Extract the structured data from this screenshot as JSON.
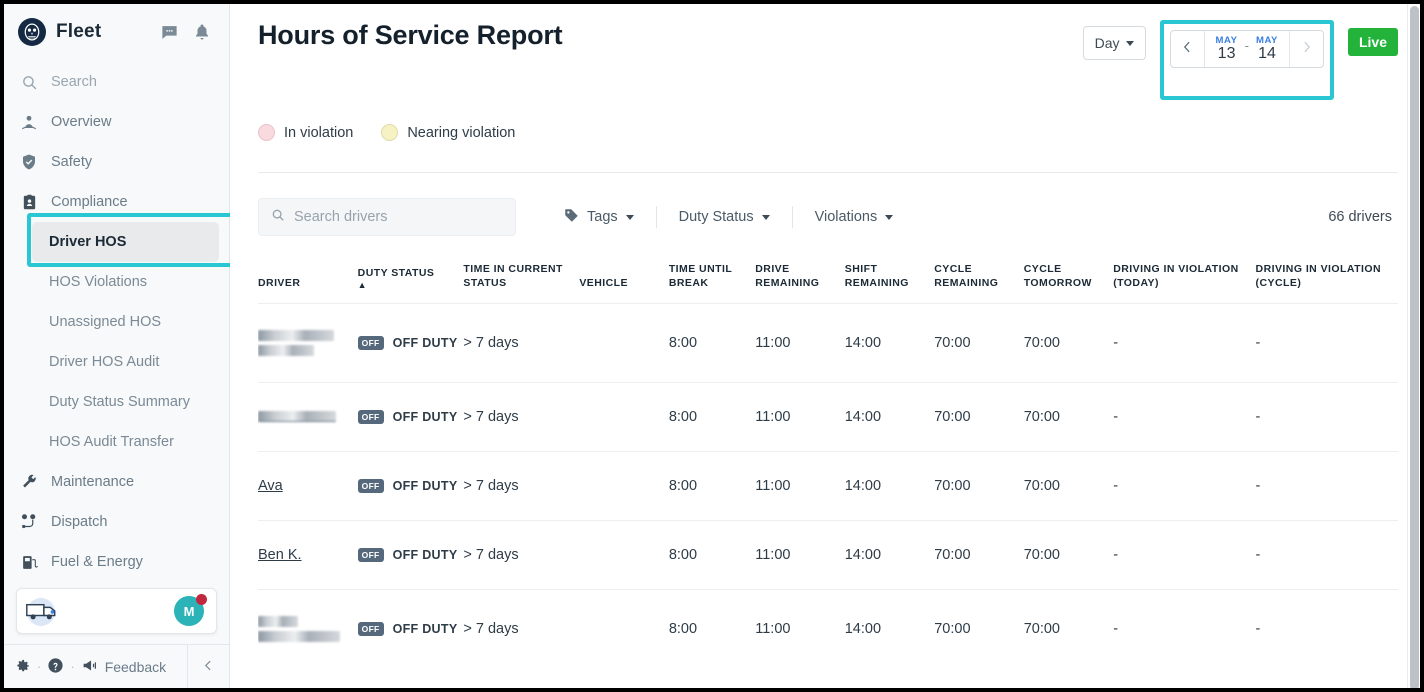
{
  "sidebar": {
    "brand": "Fleet",
    "logo_icon": "owl-logo-icon",
    "header_icons": [
      {
        "name": "chat-icon",
        "label": "Messages"
      },
      {
        "name": "bell-icon",
        "label": "Notifications"
      }
    ],
    "items": [
      {
        "label": "Search",
        "icon": "search-icon",
        "type": "nav",
        "muted": true
      },
      {
        "label": "Overview",
        "icon": "map-pin-icon",
        "type": "nav"
      },
      {
        "label": "Safety",
        "icon": "shield-check-icon",
        "type": "nav"
      },
      {
        "label": "Compliance",
        "icon": "clipboard-id-icon",
        "type": "nav"
      },
      {
        "label": "Driver HOS",
        "type": "sub",
        "active": true
      },
      {
        "label": "HOS Violations",
        "type": "sub"
      },
      {
        "label": "Unassigned HOS",
        "type": "sub"
      },
      {
        "label": "Driver HOS Audit",
        "type": "sub"
      },
      {
        "label": "Duty Status Summary",
        "type": "sub"
      },
      {
        "label": "HOS Audit Transfer",
        "type": "sub"
      },
      {
        "label": "Maintenance",
        "icon": "wrench-icon",
        "type": "nav"
      },
      {
        "label": "Dispatch",
        "icon": "route-icon",
        "type": "nav"
      },
      {
        "label": "Fuel & Energy",
        "icon": "fuel-pump-icon",
        "type": "nav"
      }
    ],
    "vehicle_card": {
      "truck_icon": "truck-icon",
      "avatar_initial": "M",
      "avatar_color": "#2bb3b8",
      "badge_color": "#c0283d"
    },
    "footer": {
      "gear_icon": "gear-icon",
      "help_icon": "help-circle-icon",
      "megaphone_icon": "megaphone-icon",
      "feedback_label": "Feedback",
      "collapse_icon": "chevron-left-icon",
      "separator": "·"
    },
    "highlight_color": "#29c7d4"
  },
  "header": {
    "title": "Hours of Service Report",
    "day_selector": {
      "label": "Day",
      "caret_icon": "caret-down-icon"
    },
    "date_range": {
      "prev_icon": "chevron-left-icon",
      "next_icon": "chevron-right-icon",
      "start_month": "MAY",
      "start_day": "13",
      "separator": "-",
      "end_month": "MAY",
      "end_day": "14",
      "month_color": "#3a7fe0"
    },
    "live_button": {
      "label": "Live",
      "color": "#23b33a"
    }
  },
  "legend": [
    {
      "label": "In violation",
      "color": "#f9dadf"
    },
    {
      "label": "Nearing violation",
      "color": "#f6f2c4"
    }
  ],
  "filters": {
    "search": {
      "placeholder": "Search drivers",
      "icon": "search-icon",
      "value": ""
    },
    "buttons": [
      {
        "label": "Tags",
        "icon": "tag-icon",
        "caret_icon": "caret-down-icon"
      },
      {
        "label": "Duty Status",
        "caret_icon": "caret-down-icon"
      },
      {
        "label": "Violations",
        "caret_icon": "caret-down-icon"
      }
    ],
    "drivers_count": "66 drivers"
  },
  "table": {
    "columns": [
      {
        "label": "DRIVER",
        "sorted": false
      },
      {
        "label": "DUTY STATUS",
        "sorted": true,
        "sort_icon": "sort-asc-icon"
      },
      {
        "label": "TIME IN CURRENT STATUS",
        "sorted": false
      },
      {
        "label": "VEHICLE",
        "sorted": false
      },
      {
        "label": "TIME UNTIL BREAK",
        "sorted": false
      },
      {
        "label": "DRIVE REMAINING",
        "sorted": false
      },
      {
        "label": "SHIFT REMAINING",
        "sorted": false
      },
      {
        "label": "CYCLE REMAINING",
        "sorted": false
      },
      {
        "label": "CYCLE TOMORROW",
        "sorted": false
      },
      {
        "label": "DRIVING IN VIOLATION (TODAY)",
        "sorted": false
      },
      {
        "label": "DRIVING IN VIOLATION (CYCLE)",
        "sorted": false
      }
    ],
    "rows": [
      {
        "driver": "",
        "driver_redacted": true,
        "redact_lines": 2,
        "duty_badge": "OFF",
        "duty_status": "OFF DUTY",
        "time_in_status": "> 7 days",
        "vehicle": "",
        "time_until_break": "8:00",
        "drive_remaining": "11:00",
        "shift_remaining": "14:00",
        "cycle_remaining": "70:00",
        "cycle_tomorrow": "70:00",
        "violation_today": "-",
        "violation_cycle": "-"
      },
      {
        "driver": "",
        "driver_redacted": true,
        "redact_lines": 1,
        "duty_badge": "OFF",
        "duty_status": "OFF DUTY",
        "time_in_status": "> 7 days",
        "vehicle": "",
        "time_until_break": "8:00",
        "drive_remaining": "11:00",
        "shift_remaining": "14:00",
        "cycle_remaining": "70:00",
        "cycle_tomorrow": "70:00",
        "violation_today": "-",
        "violation_cycle": "-"
      },
      {
        "driver": "Ava",
        "driver_redacted": false,
        "duty_badge": "OFF",
        "duty_status": "OFF DUTY",
        "time_in_status": "> 7 days",
        "vehicle": "",
        "time_until_break": "8:00",
        "drive_remaining": "11:00",
        "shift_remaining": "14:00",
        "cycle_remaining": "70:00",
        "cycle_tomorrow": "70:00",
        "violation_today": "-",
        "violation_cycle": "-"
      },
      {
        "driver": "Ben K.",
        "driver_redacted": false,
        "duty_badge": "OFF",
        "duty_status": "OFF DUTY",
        "time_in_status": "> 7 days",
        "vehicle": "",
        "time_until_break": "8:00",
        "drive_remaining": "11:00",
        "shift_remaining": "14:00",
        "cycle_remaining": "70:00",
        "cycle_tomorrow": "70:00",
        "violation_today": "-",
        "violation_cycle": "-"
      },
      {
        "driver": "",
        "driver_redacted": true,
        "redact_lines": 2,
        "duty_badge": "OFF",
        "duty_status": "OFF DUTY",
        "time_in_status": "> 7 days",
        "vehicle": "",
        "time_until_break": "8:00",
        "drive_remaining": "11:00",
        "shift_remaining": "14:00",
        "cycle_remaining": "70:00",
        "cycle_tomorrow": "70:00",
        "violation_today": "-",
        "violation_cycle": "-"
      }
    ]
  }
}
